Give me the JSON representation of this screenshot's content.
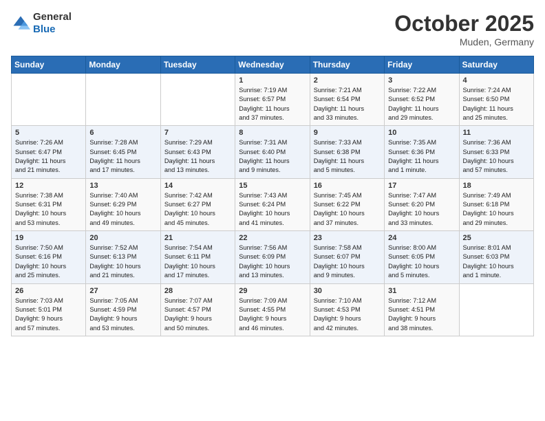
{
  "header": {
    "logo_general": "General",
    "logo_blue": "Blue",
    "month": "October 2025",
    "location": "Muden, Germany"
  },
  "weekdays": [
    "Sunday",
    "Monday",
    "Tuesday",
    "Wednesday",
    "Thursday",
    "Friday",
    "Saturday"
  ],
  "weeks": [
    [
      {
        "day": "",
        "info": ""
      },
      {
        "day": "",
        "info": ""
      },
      {
        "day": "",
        "info": ""
      },
      {
        "day": "1",
        "info": "Sunrise: 7:19 AM\nSunset: 6:57 PM\nDaylight: 11 hours\nand 37 minutes."
      },
      {
        "day": "2",
        "info": "Sunrise: 7:21 AM\nSunset: 6:54 PM\nDaylight: 11 hours\nand 33 minutes."
      },
      {
        "day": "3",
        "info": "Sunrise: 7:22 AM\nSunset: 6:52 PM\nDaylight: 11 hours\nand 29 minutes."
      },
      {
        "day": "4",
        "info": "Sunrise: 7:24 AM\nSunset: 6:50 PM\nDaylight: 11 hours\nand 25 minutes."
      }
    ],
    [
      {
        "day": "5",
        "info": "Sunrise: 7:26 AM\nSunset: 6:47 PM\nDaylight: 11 hours\nand 21 minutes."
      },
      {
        "day": "6",
        "info": "Sunrise: 7:28 AM\nSunset: 6:45 PM\nDaylight: 11 hours\nand 17 minutes."
      },
      {
        "day": "7",
        "info": "Sunrise: 7:29 AM\nSunset: 6:43 PM\nDaylight: 11 hours\nand 13 minutes."
      },
      {
        "day": "8",
        "info": "Sunrise: 7:31 AM\nSunset: 6:40 PM\nDaylight: 11 hours\nand 9 minutes."
      },
      {
        "day": "9",
        "info": "Sunrise: 7:33 AM\nSunset: 6:38 PM\nDaylight: 11 hours\nand 5 minutes."
      },
      {
        "day": "10",
        "info": "Sunrise: 7:35 AM\nSunset: 6:36 PM\nDaylight: 11 hours\nand 1 minute."
      },
      {
        "day": "11",
        "info": "Sunrise: 7:36 AM\nSunset: 6:33 PM\nDaylight: 10 hours\nand 57 minutes."
      }
    ],
    [
      {
        "day": "12",
        "info": "Sunrise: 7:38 AM\nSunset: 6:31 PM\nDaylight: 10 hours\nand 53 minutes."
      },
      {
        "day": "13",
        "info": "Sunrise: 7:40 AM\nSunset: 6:29 PM\nDaylight: 10 hours\nand 49 minutes."
      },
      {
        "day": "14",
        "info": "Sunrise: 7:42 AM\nSunset: 6:27 PM\nDaylight: 10 hours\nand 45 minutes."
      },
      {
        "day": "15",
        "info": "Sunrise: 7:43 AM\nSunset: 6:24 PM\nDaylight: 10 hours\nand 41 minutes."
      },
      {
        "day": "16",
        "info": "Sunrise: 7:45 AM\nSunset: 6:22 PM\nDaylight: 10 hours\nand 37 minutes."
      },
      {
        "day": "17",
        "info": "Sunrise: 7:47 AM\nSunset: 6:20 PM\nDaylight: 10 hours\nand 33 minutes."
      },
      {
        "day": "18",
        "info": "Sunrise: 7:49 AM\nSunset: 6:18 PM\nDaylight: 10 hours\nand 29 minutes."
      }
    ],
    [
      {
        "day": "19",
        "info": "Sunrise: 7:50 AM\nSunset: 6:16 PM\nDaylight: 10 hours\nand 25 minutes."
      },
      {
        "day": "20",
        "info": "Sunrise: 7:52 AM\nSunset: 6:13 PM\nDaylight: 10 hours\nand 21 minutes."
      },
      {
        "day": "21",
        "info": "Sunrise: 7:54 AM\nSunset: 6:11 PM\nDaylight: 10 hours\nand 17 minutes."
      },
      {
        "day": "22",
        "info": "Sunrise: 7:56 AM\nSunset: 6:09 PM\nDaylight: 10 hours\nand 13 minutes."
      },
      {
        "day": "23",
        "info": "Sunrise: 7:58 AM\nSunset: 6:07 PM\nDaylight: 10 hours\nand 9 minutes."
      },
      {
        "day": "24",
        "info": "Sunrise: 8:00 AM\nSunset: 6:05 PM\nDaylight: 10 hours\nand 5 minutes."
      },
      {
        "day": "25",
        "info": "Sunrise: 8:01 AM\nSunset: 6:03 PM\nDaylight: 10 hours\nand 1 minute."
      }
    ],
    [
      {
        "day": "26",
        "info": "Sunrise: 7:03 AM\nSunset: 5:01 PM\nDaylight: 9 hours\nand 57 minutes."
      },
      {
        "day": "27",
        "info": "Sunrise: 7:05 AM\nSunset: 4:59 PM\nDaylight: 9 hours\nand 53 minutes."
      },
      {
        "day": "28",
        "info": "Sunrise: 7:07 AM\nSunset: 4:57 PM\nDaylight: 9 hours\nand 50 minutes."
      },
      {
        "day": "29",
        "info": "Sunrise: 7:09 AM\nSunset: 4:55 PM\nDaylight: 9 hours\nand 46 minutes."
      },
      {
        "day": "30",
        "info": "Sunrise: 7:10 AM\nSunset: 4:53 PM\nDaylight: 9 hours\nand 42 minutes."
      },
      {
        "day": "31",
        "info": "Sunrise: 7:12 AM\nSunset: 4:51 PM\nDaylight: 9 hours\nand 38 minutes."
      },
      {
        "day": "",
        "info": ""
      }
    ]
  ]
}
